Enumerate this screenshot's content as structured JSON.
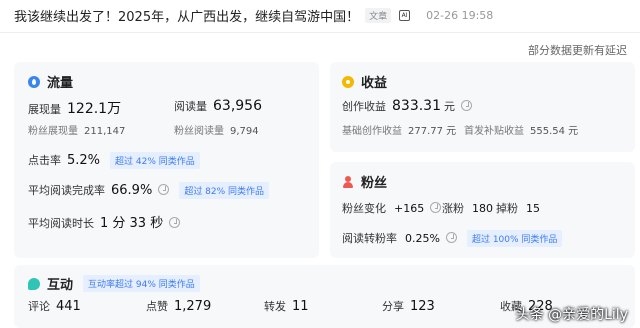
{
  "header": {
    "title": "我该继续出发了！2025年，从广西出发，继续自驾游中国！",
    "tag": "文章",
    "ai_icon": "AI",
    "time": "02-26 19:58"
  },
  "notice": "部分数据更新有延迟",
  "traffic": {
    "title": "流量",
    "impressions_label": "展现量",
    "impressions_value": "122.1万",
    "reads_label": "阅读量",
    "reads_value": "63,956",
    "fan_impressions_label": "粉丝展现量",
    "fan_impressions_value": "211,147",
    "fan_reads_label": "粉丝阅读量",
    "fan_reads_value": "9,794",
    "ctr_label": "点击率",
    "ctr_value": "5.2%",
    "ctr_badge": "超过 42% 同类作品",
    "completion_label": "平均阅读完成率",
    "completion_value": "66.9%",
    "completion_badge": "超过 82% 同类作品",
    "duration_label": "平均阅读时长",
    "duration_value": "1 分 33 秒"
  },
  "income": {
    "title": "收益",
    "creation_label": "创作收益",
    "creation_value": "833.31",
    "creation_unit": "元",
    "base_label": "基础创作收益",
    "base_value": "277.77 元",
    "subsidy_label": "首发补贴收益",
    "subsidy_value": "555.54 元"
  },
  "fans": {
    "title": "粉丝",
    "change_label": "粉丝变化",
    "change_value": "+165",
    "gain_label": "涨粉",
    "gain_value": "180",
    "loss_label": "掉粉",
    "loss_value": "15",
    "conversion_label": "阅读转粉率",
    "conversion_value": "0.25%",
    "conversion_badge": "超过 100% 同类作品"
  },
  "interaction": {
    "title": "互动",
    "badge": "互动率超过 94% 同类作品",
    "comments_label": "评论",
    "comments_value": "441",
    "likes_label": "点赞",
    "likes_value": "1,279",
    "reposts_label": "转发",
    "reposts_value": "11",
    "shares_label": "分享",
    "shares_value": "123",
    "favorites_label": "收藏",
    "favorites_value": "228"
  },
  "watermark": "头条 @亲爱的Lily",
  "colors": {
    "accent": "#3d7bf2",
    "badge_bg": "#e6efff",
    "card_bg": "#f7f8fa",
    "traffic_icon": "#3a86f0",
    "income_icon": "#f5b800",
    "fans_icon": "#ee5a52",
    "interaction_icon": "#2ec4b6"
  }
}
